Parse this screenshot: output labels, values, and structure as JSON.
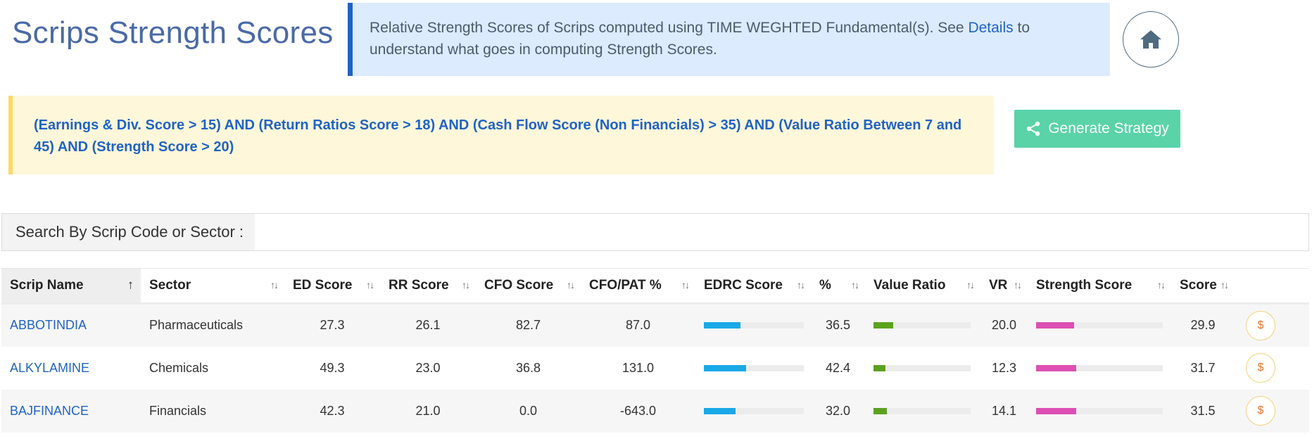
{
  "page": {
    "title": "Scrips Strength Scores"
  },
  "info": {
    "text_before": "Relative Strength Scores of Scrips computed using TIME WEGHTED Fundamental(s). See ",
    "details_link": "Details",
    "text_after": " to understand what goes in computing Strength Scores."
  },
  "home": {
    "icon": "home-icon"
  },
  "criteria": {
    "text": "(Earnings & Div. Score > 15) AND (Return Ratios Score > 18) AND (Cash Flow Score (Non Financials) > 35) AND (Value Ratio Between 7 and 45) AND (Strength Score > 20)"
  },
  "generate": {
    "label": "Generate Strategy",
    "icon": "share-icon"
  },
  "search": {
    "label": "Search By Scrip Code or Sector :",
    "value": "",
    "placeholder": ""
  },
  "table": {
    "headers": [
      "Scrip Name",
      "Sector",
      "ED Score",
      "RR Score",
      "CFO Score",
      "CFO/PAT %",
      "EDRC Score",
      "%",
      "Value Ratio",
      "VR",
      "Strength Score",
      "Score"
    ],
    "sort_icons": {
      "active": "↑",
      "inactive": "↑↓"
    },
    "rows": [
      {
        "scrip": "ABBOTINDIA",
        "sector": "Pharmaceuticals",
        "ed": "27.3",
        "rr": "26.1",
        "cfo": "82.7",
        "cfo_pat": "87.0",
        "edrc_pct": 36.5,
        "edrc_text": "36.5",
        "vr_pct": 20.0,
        "vr_text": "20.0",
        "strength_pct": 29.9,
        "score_text": "29.9"
      },
      {
        "scrip": "ALKYLAMINE",
        "sector": "Chemicals",
        "ed": "49.3",
        "rr": "23.0",
        "cfo": "36.8",
        "cfo_pat": "131.0",
        "edrc_pct": 42.4,
        "edrc_text": "42.4",
        "vr_pct": 12.3,
        "vr_text": "12.3",
        "strength_pct": 31.7,
        "score_text": "31.7"
      },
      {
        "scrip": "BAJFINANCE",
        "sector": "Financials",
        "ed": "42.3",
        "rr": "21.0",
        "cfo": "0.0",
        "cfo_pat": "-643.0",
        "edrc_pct": 32.0,
        "edrc_text": "32.0",
        "vr_pct": 14.1,
        "vr_text": "14.1",
        "strength_pct": 31.5,
        "score_text": "31.5"
      }
    ],
    "action_icon": "$"
  },
  "colors": {
    "edrc_bar": "#1aa9e6",
    "vr_bar": "#5ca21f",
    "strength_bar": "#dd4fb4",
    "link": "#1f63c6",
    "accent_green": "#5ad3a8"
  }
}
